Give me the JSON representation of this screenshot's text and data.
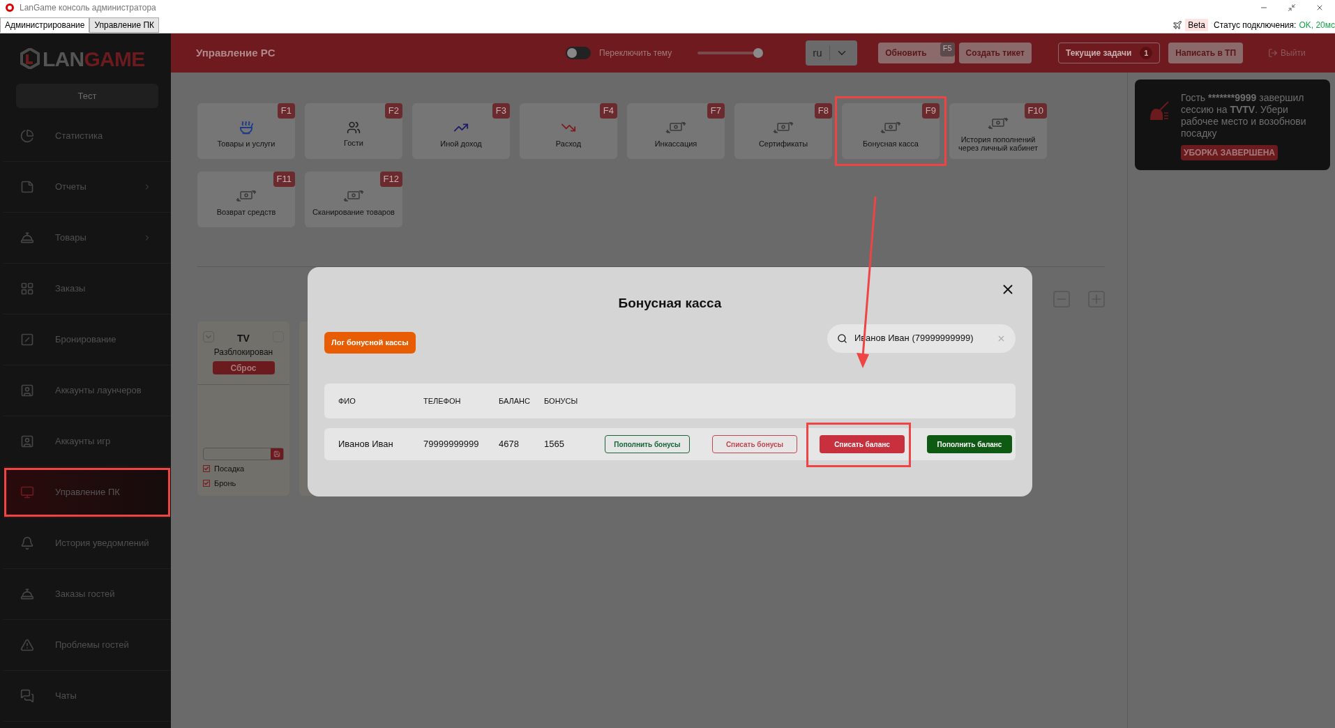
{
  "window": {
    "title": "LanGame консоль администратора",
    "tabs": [
      {
        "label": "Администрирование",
        "selected": true
      },
      {
        "label": "Управление ПК",
        "selected": false
      }
    ],
    "beta": "Beta",
    "status_label": "Статус подключения:",
    "status_value": "OK, 20мс"
  },
  "sidebar": {
    "brand_a": "LAN",
    "brand_b": "GAME",
    "club": "Тест",
    "items": [
      {
        "label": "Статистика",
        "selected": false,
        "expandable": false,
        "highlighted": false
      },
      {
        "label": "Отчеты",
        "selected": false,
        "expandable": true,
        "highlighted": false
      },
      {
        "label": "Товары",
        "selected": false,
        "expandable": true,
        "highlighted": false
      },
      {
        "label": "Заказы",
        "selected": false,
        "expandable": false,
        "highlighted": false
      },
      {
        "label": "Бронирование",
        "selected": false,
        "expandable": false,
        "highlighted": false
      },
      {
        "label": "Аккаунты лаунчеров",
        "selected": false,
        "expandable": false,
        "highlighted": false
      },
      {
        "label": "Аккаунты игр",
        "selected": false,
        "expandable": false,
        "highlighted": false
      },
      {
        "label": "Управление ПК",
        "selected": true,
        "expandable": false,
        "highlighted": true
      },
      {
        "label": "История уведомлений",
        "selected": false,
        "expandable": false,
        "highlighted": false
      },
      {
        "label": "Заказы гостей",
        "selected": false,
        "expandable": false,
        "highlighted": false
      },
      {
        "label": "Проблемы гостей",
        "selected": false,
        "expandable": false,
        "highlighted": false
      },
      {
        "label": "Чаты",
        "selected": false,
        "expandable": false,
        "highlighted": false
      }
    ]
  },
  "header": {
    "title": "Управление PC",
    "theme_toggle": {
      "label": "Переключить тему",
      "on": false
    },
    "slider": {
      "level": 0.9
    },
    "language": "ru",
    "buttons": [
      {
        "label": "Обновить",
        "key": "F5"
      },
      {
        "label": "Создать тикет"
      }
    ],
    "tasks": {
      "label": "Текущие задачи",
      "count": "1"
    },
    "support": "Написать в ТП",
    "logout": "Выйти"
  },
  "tiles": [
    {
      "label": "Товары и услуги",
      "key": "F1",
      "highlighted": false
    },
    {
      "label": "Гости",
      "key": "F2",
      "highlighted": false
    },
    {
      "label": "Иной доход",
      "key": "F3",
      "highlighted": false
    },
    {
      "label": "Расход",
      "key": "F4",
      "highlighted": false
    },
    {
      "label": "Инкассация",
      "key": "F7",
      "highlighted": false
    },
    {
      "label": "Сертификаты",
      "key": "F8",
      "highlighted": false
    },
    {
      "label": "Бонусная касса",
      "key": "F9",
      "highlighted": true
    },
    {
      "label": "История пополнений через личный кабинет",
      "key": "F10",
      "highlighted": false
    },
    {
      "label": "Возврат средств",
      "key": "F11",
      "highlighted": false
    },
    {
      "label": "Сканирование товаров",
      "key": "F12",
      "highlighted": false
    }
  ],
  "pc_card": {
    "name": "TV",
    "status": "Разблокирован",
    "reset": "Сброс",
    "options": [
      {
        "label": "Посадка",
        "checked": true
      },
      {
        "label": "Бронь",
        "checked": true
      }
    ]
  },
  "notification": {
    "message": [
      {
        "text": "Гость ",
        "bold": false
      },
      {
        "text": "*******9999",
        "bold": true
      },
      {
        "text": " завершил сессию на ",
        "bold": false
      },
      {
        "text": "TVTV",
        "bold": true
      },
      {
        "text": ". Убери рабочее место и возобнови посадку",
        "bold": false
      }
    ],
    "action": "УБОРКА ЗАВЕРШЕНА"
  },
  "modal": {
    "title": "Бонусная касса",
    "log_button": "Лог бонусной кассы",
    "search": {
      "value": "Иванов Иван (79999999999)"
    },
    "columns": [
      "ФИО",
      "ТЕЛЕФОН",
      "БАЛАНС",
      "БОНУСЫ"
    ],
    "rows": [
      {
        "name": "Иванов Иван",
        "phone": "79999999999",
        "balance": "4678",
        "bonuses": "1565"
      }
    ],
    "actions": [
      {
        "label": "Пополнить бонусы",
        "kind": "outline-green",
        "highlighted": false
      },
      {
        "label": "Списать бонусы",
        "kind": "outline-red",
        "highlighted": false
      },
      {
        "label": "Списать баланс",
        "kind": "solid-red",
        "highlighted": true
      },
      {
        "label": "Пополнить баланс",
        "kind": "solid-green",
        "highlighted": false
      }
    ]
  }
}
